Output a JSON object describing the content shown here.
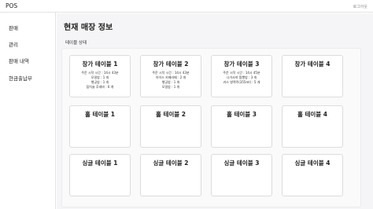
{
  "header": {
    "app_title": "POS",
    "logout_label": "로그아웃"
  },
  "sidebar": {
    "items": [
      {
        "label": "판매"
      },
      {
        "label": "관리"
      },
      {
        "label": "판매 내역"
      },
      {
        "label": "현금출납부"
      }
    ]
  },
  "main": {
    "page_title": "현재 매장 정보",
    "section_label": "테이블 상태",
    "tables": [
      {
        "name": "창가 테이블 1",
        "lines": [
          "주문 시작 시간 : 14시 43분",
          "모밀밥 : 1 개",
          "행궁밥 : 1 개",
          "잠치술 후레바 : 6 개"
        ]
      },
      {
        "name": "창가 테이블 2",
        "lines": [
          "주문 시작 시간 : 14시 43분",
          "아이스 카페라떼 : 2 개",
          "행궁밥 : 1 개",
          "모밀밥 : 1 개"
        ]
      },
      {
        "name": "창가 테이블 3",
        "lines": [
          "주문 시작 시간 : 14시 45분",
          "나가사끼 짬뽕밥 : 3 개",
          "카스 병맥주(355ml) : 5 개"
        ]
      },
      {
        "name": "창가 테이블 4",
        "lines": []
      },
      {
        "name": "홀 테이블 1",
        "lines": []
      },
      {
        "name": "홀 테이블 2",
        "lines": []
      },
      {
        "name": "홀 테이블 3",
        "lines": []
      },
      {
        "name": "홀 테이블 4",
        "lines": []
      },
      {
        "name": "싱글 테이블 1",
        "lines": []
      },
      {
        "name": "싱글 테이블 2",
        "lines": []
      },
      {
        "name": "싱글 테이블 3",
        "lines": []
      },
      {
        "name": "싱글 테이블 4",
        "lines": []
      }
    ]
  }
}
